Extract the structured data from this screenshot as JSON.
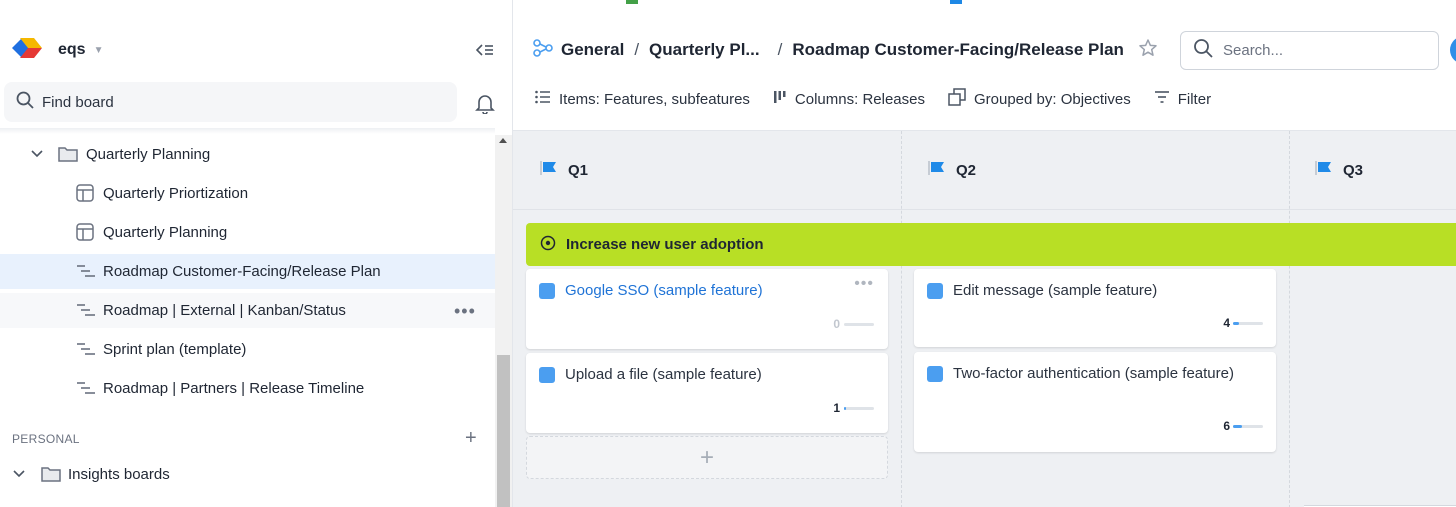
{
  "workspace": {
    "name": "eqs"
  },
  "sidebar": {
    "find_placeholder": "Find board",
    "tree": [
      {
        "label": "Quarterly Planning",
        "icon": "folder-icon",
        "kind": "folder",
        "expanded": true
      },
      {
        "label": "Quarterly Priortization",
        "icon": "table-board-icon"
      },
      {
        "label": "Quarterly Planning",
        "icon": "table-board-icon"
      },
      {
        "label": "Roadmap Customer-Facing/Release Plan",
        "icon": "roadmap-board-icon",
        "selected": true
      },
      {
        "label": "Roadmap | External | Kanban/Status",
        "icon": "roadmap-board-icon",
        "more": "•••"
      },
      {
        "label": "Sprint plan (template)",
        "icon": "roadmap-board-icon"
      },
      {
        "label": "Roadmap | Partners | Release Timeline",
        "icon": "roadmap-board-icon"
      }
    ],
    "personal_section": "PERSONAL",
    "personal_folder": "Insights boards"
  },
  "header": {
    "breadcrumb": [
      "General",
      "Quarterly Pl...",
      "Roadmap Customer-Facing/Release Plan"
    ],
    "separator": "/",
    "search_placeholder": "Search..."
  },
  "toolbar": {
    "items_label": "Items: Features, subfeatures",
    "columns_label": "Columns: Releases",
    "grouped_label": "Grouped by: Objectives",
    "filter_label": "Filter"
  },
  "board": {
    "columns": [
      "Q1",
      "Q2",
      "Q3"
    ],
    "group_label": "Increase new user adoption",
    "cards": {
      "q1": [
        {
          "title": "Google SSO (sample feature)",
          "count": "0",
          "progress": 0,
          "more": "•••"
        },
        {
          "title": "Upload a file (sample feature)",
          "count": "1",
          "progress": 0.05
        }
      ],
      "q2": [
        {
          "title": "Edit message (sample feature)",
          "count": "4",
          "progress": 0.2
        },
        {
          "title": "Two-factor authentication (sample feature)",
          "count": "6",
          "progress": 0.3
        }
      ]
    },
    "add_card": "+"
  },
  "colors": {
    "accent": "#4b9ef0",
    "group": "#b8df25",
    "selected_row": "#e8f1fd",
    "link": "#1f73d6"
  }
}
